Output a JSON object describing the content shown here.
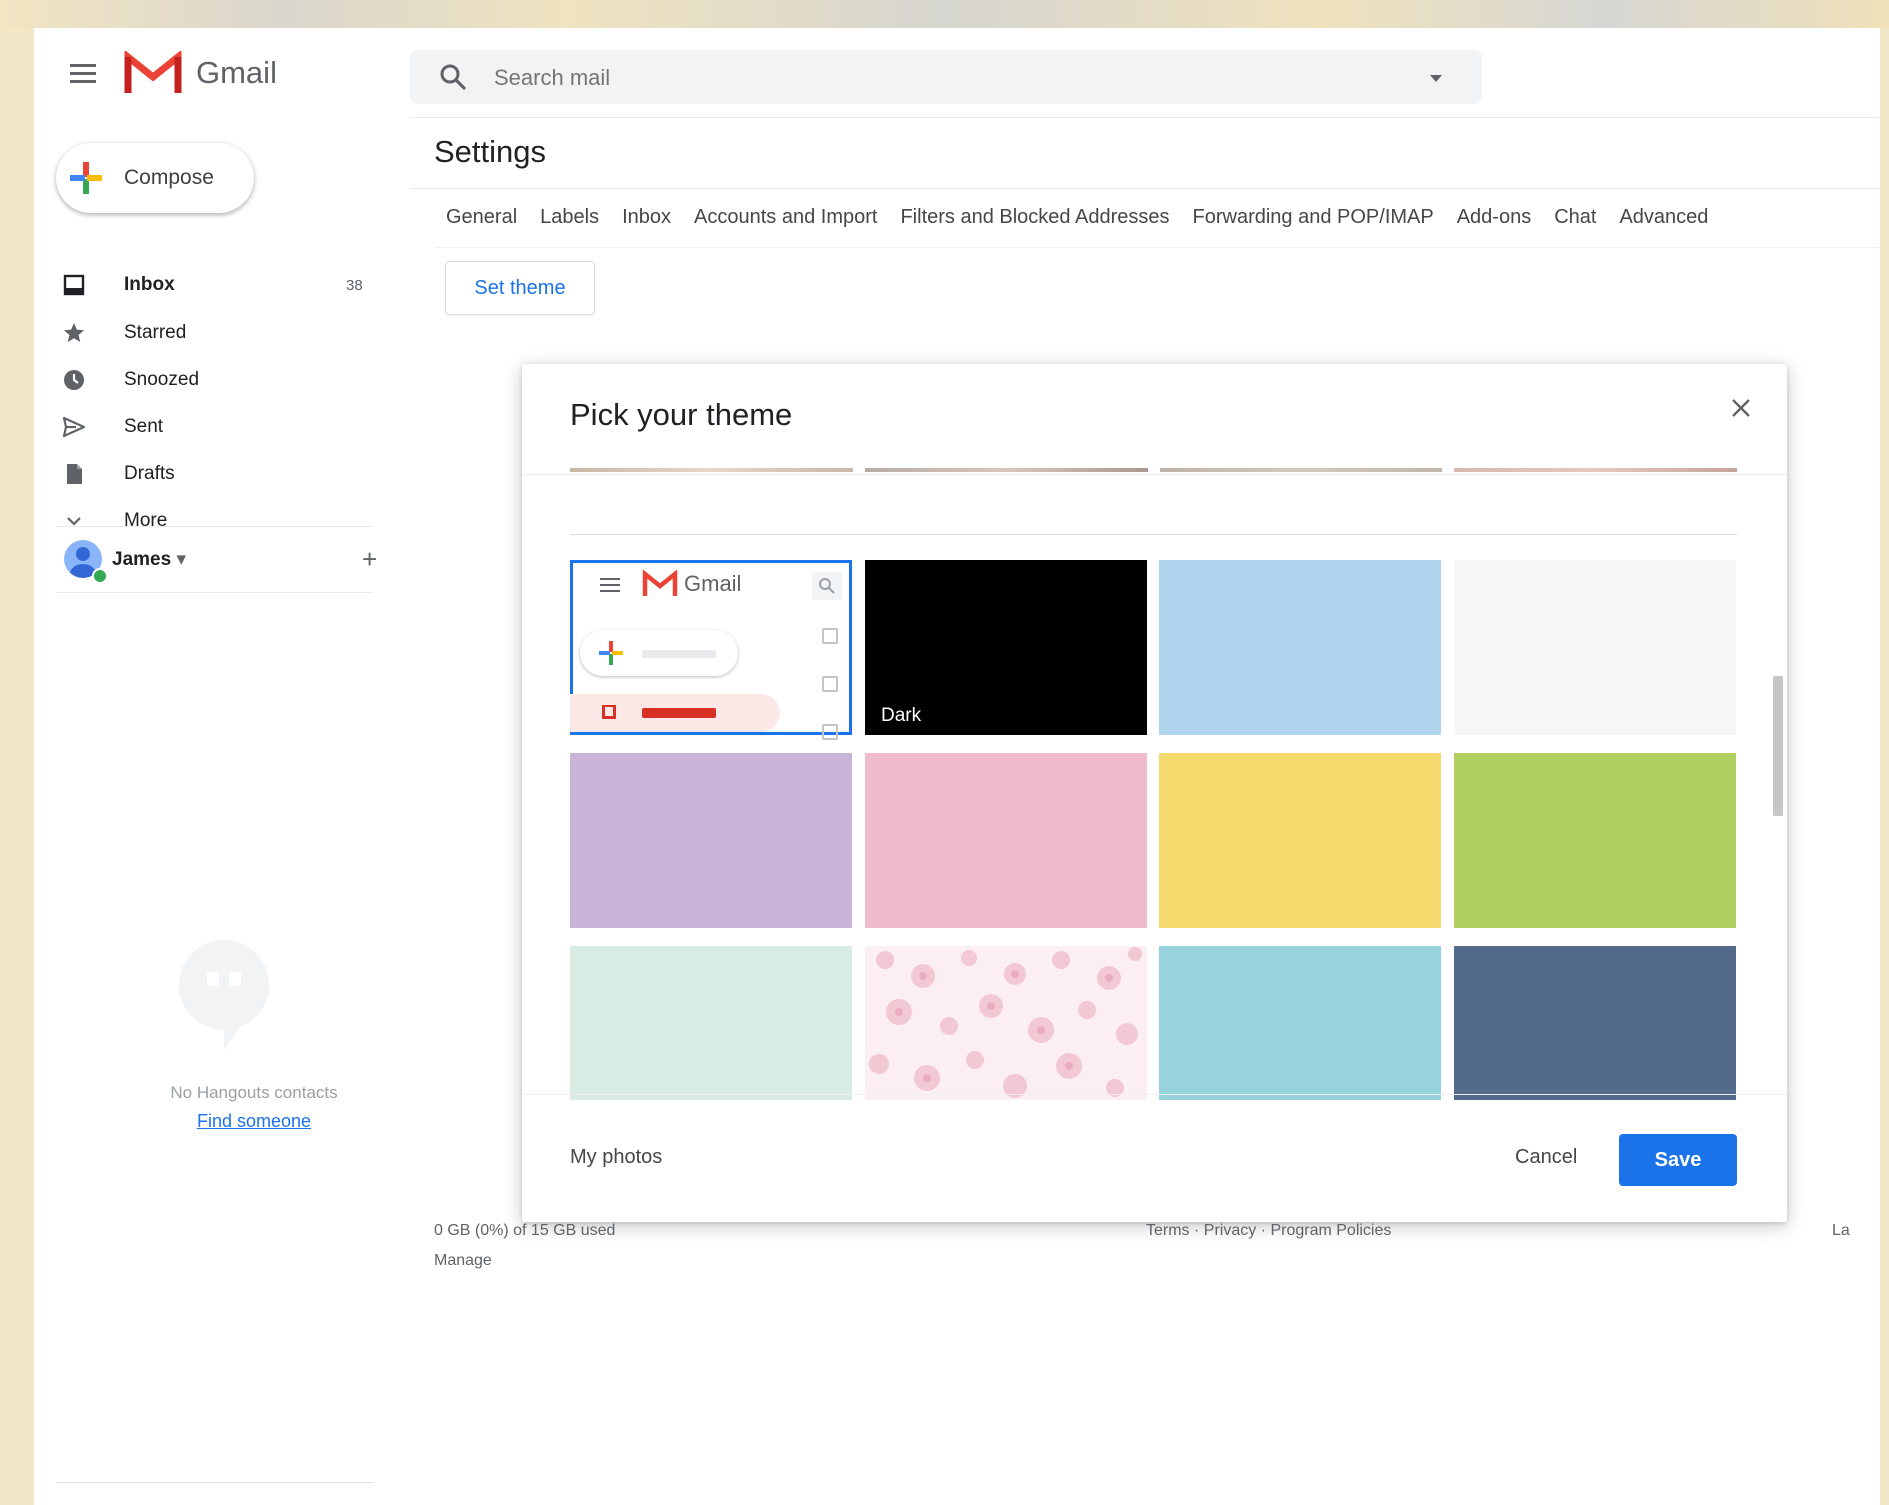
{
  "app": {
    "name": "Gmail"
  },
  "search": {
    "placeholder": "Search mail"
  },
  "sidebar": {
    "compose_label": "Compose",
    "items": [
      {
        "label": "Inbox",
        "count": "38",
        "icon": "inbox-icon",
        "bold": true
      },
      {
        "label": "Starred",
        "count": "",
        "icon": "star-icon"
      },
      {
        "label": "Snoozed",
        "count": "",
        "icon": "clock-icon"
      },
      {
        "label": "Sent",
        "count": "",
        "icon": "send-icon"
      },
      {
        "label": "Drafts",
        "count": "",
        "icon": "draft-icon"
      },
      {
        "label": "More",
        "count": "",
        "icon": "chevron-down-icon"
      }
    ],
    "hangouts_user": "James",
    "no_contacts": "No Hangouts contacts",
    "find_someone": "Find someone"
  },
  "settings": {
    "title": "Settings",
    "tabs": [
      "General",
      "Labels",
      "Inbox",
      "Accounts and Import",
      "Filters and Blocked Addresses",
      "Forwarding and POP/IMAP",
      "Add-ons",
      "Chat",
      "Advanced"
    ],
    "set_theme_label": "Set theme"
  },
  "theme_dialog": {
    "title": "Pick your theme",
    "default_theme_logo": "Gmail",
    "themes": [
      {
        "label": "",
        "color": "#ffffff",
        "kind": "default",
        "selected": true
      },
      {
        "label": "Dark",
        "color": "#000000"
      },
      {
        "label": "",
        "color": "#b1d4ef"
      },
      {
        "label": "",
        "color": "#f6f6f6"
      },
      {
        "label": "",
        "color": "#c8b4d9"
      },
      {
        "label": "",
        "color": "#f0bccd"
      },
      {
        "label": "",
        "color": "#f4da6c"
      },
      {
        "label": "",
        "color": "#afd061"
      },
      {
        "label": "",
        "color": "#d9ece3"
      },
      {
        "label": "",
        "color": "#fbeff3",
        "kind": "floral"
      },
      {
        "label": "",
        "color": "#97d3dd"
      },
      {
        "label": "",
        "color": "#546a8c"
      }
    ],
    "my_photos_label": "My photos",
    "cancel_label": "Cancel",
    "save_label": "Save"
  },
  "footer": {
    "storage": "0 GB (0%) of 15 GB used",
    "manage": "Manage",
    "policies": "Terms · Privacy · Program Policies",
    "last_activity": "La"
  },
  "colors": {
    "accent": "#1a73e8",
    "gmail_red": "#ea4335",
    "background_frame": "#f1e6c6"
  }
}
